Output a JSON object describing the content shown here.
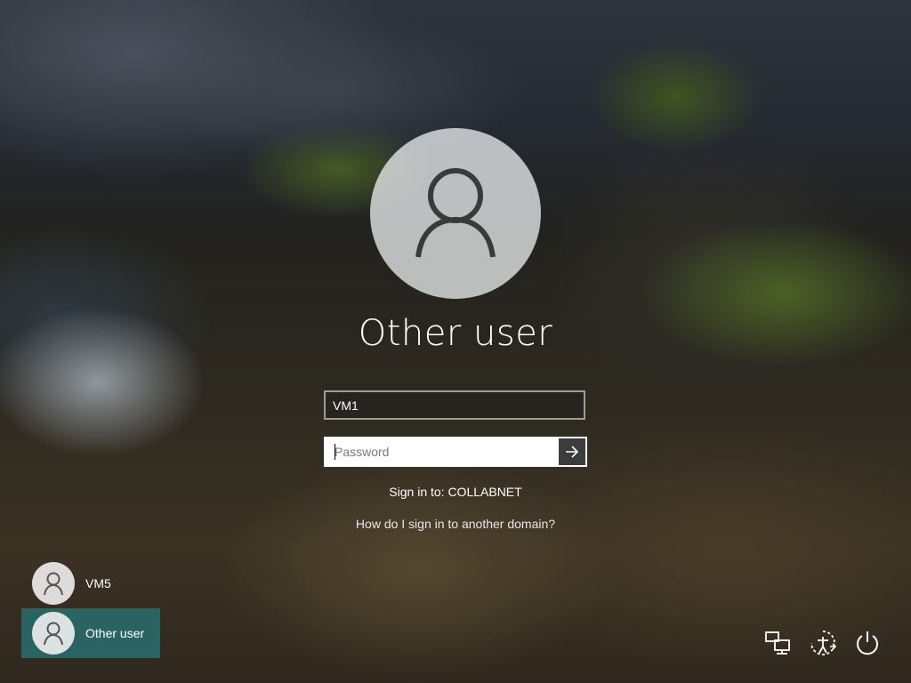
{
  "screen": {
    "title": "Other user",
    "username_value": "VM1",
    "password_placeholder": "Password",
    "sign_in_to": "Sign in to: COLLABNET",
    "other_domain_link": "How do I sign in to another domain?"
  },
  "users": [
    {
      "label": "VM5",
      "selected": false
    },
    {
      "label": "Other user",
      "selected": true
    }
  ],
  "corner_icons": [
    "network-icon",
    "ease-of-access-icon",
    "power-icon"
  ],
  "colors": {
    "selected_tile": "#286e6e",
    "submit_button": "#3c3c3c"
  }
}
